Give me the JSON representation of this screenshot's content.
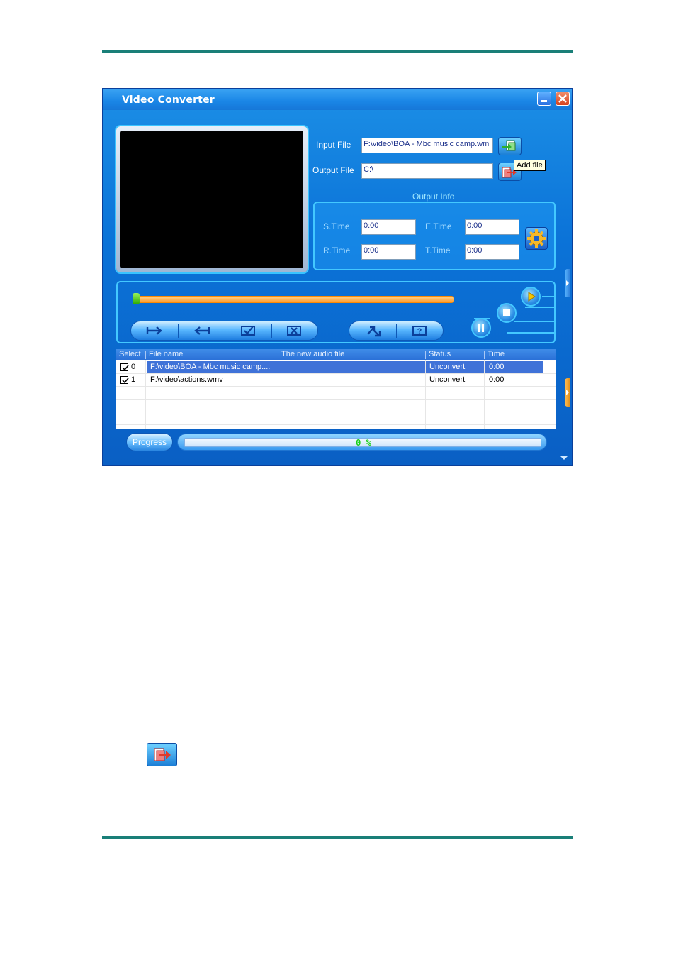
{
  "window": {
    "title": "Video Converter"
  },
  "input_file": {
    "label": "Input File",
    "value": "F:\\video\\BOA - Mbc music camp.wm",
    "button_icon": "add-file-icon"
  },
  "output_file": {
    "label": "Output File",
    "value": "C:\\",
    "button_icon": "output-folder-icon"
  },
  "tooltip": {
    "text": "Add file"
  },
  "output_info": {
    "title": "Output Info",
    "s_time": {
      "label": "S.Time",
      "value": "0:00"
    },
    "e_time": {
      "label": "E.Time",
      "value": "0:00"
    },
    "r_time": {
      "label": "R.Time",
      "value": "0:00"
    },
    "t_time": {
      "label": "T.Time",
      "value": "0:00"
    }
  },
  "playback": {
    "seek_position": 0
  },
  "file_table": {
    "columns": [
      "Select",
      "File name",
      "The new audio file",
      "Status",
      "Time"
    ],
    "rows": [
      {
        "index": "0",
        "checked": true,
        "file_name": "F:\\video\\BOA - Mbc music camp....",
        "new_audio_file": "",
        "status": "Unconvert",
        "time": "0:00",
        "selected": true
      },
      {
        "index": "1",
        "checked": true,
        "file_name": "F:\\video\\actions.wmv",
        "new_audio_file": "",
        "status": "Unconvert",
        "time": "0:00",
        "selected": false
      }
    ]
  },
  "progress": {
    "button_label": "Progress",
    "text": "0 %",
    "value": 0
  },
  "colors": {
    "window_blue": "#0b73d8",
    "accent_cyan": "#43c8ff",
    "progress_green": "#1bd11b",
    "page_rule": "#1a7f78"
  }
}
